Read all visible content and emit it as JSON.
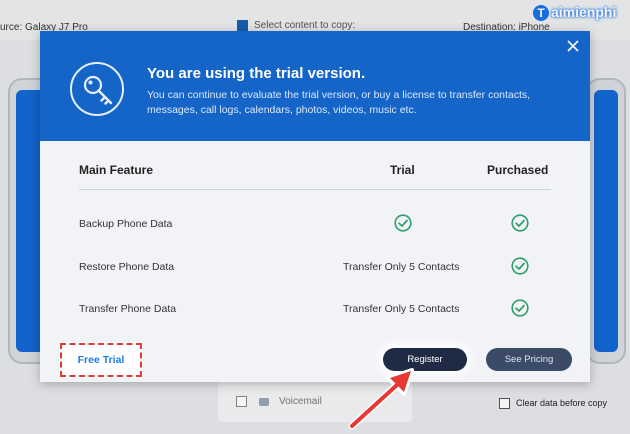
{
  "background": {
    "source_label": "urce: Galaxy J7 Pro",
    "select_label": "Select content to copy:",
    "destination_label": "Destination: iPhone",
    "voicemail_label": "Voicemail",
    "clear_label": "Clear data before copy",
    "watermark": "aimienphi"
  },
  "modal": {
    "title": "You are using the trial version.",
    "description": "You can continue to evaluate the trial version, or buy a license to transfer contacts, messages, call logs, calendars, photos, videos, music etc.",
    "headers": {
      "feature": "Main Feature",
      "trial": "Trial",
      "purchased": "Purchased"
    },
    "rows": [
      {
        "feature": "Backup Phone Data",
        "trial": "",
        "trial_check": true,
        "purchased_check": true
      },
      {
        "feature": "Restore Phone Data",
        "trial": "Transfer Only 5 Contacts",
        "trial_check": false,
        "purchased_check": true
      },
      {
        "feature": "Transfer Phone Data",
        "trial": "Transfer Only 5 Contacts",
        "trial_check": false,
        "purchased_check": true
      }
    ],
    "buttons": {
      "free_trial": "Free Trial",
      "register": "Register",
      "see_pricing": "See Pricing"
    }
  },
  "colors": {
    "header_blue": "#1565c9",
    "check_green": "#2e9e6a",
    "highlight_red": "#e53935",
    "register_bg": "#1f2a44"
  },
  "icons": {
    "header": "key-icon",
    "close": "close-icon",
    "check": "check-circle-icon",
    "annotation": "red-arrow-icon"
  }
}
